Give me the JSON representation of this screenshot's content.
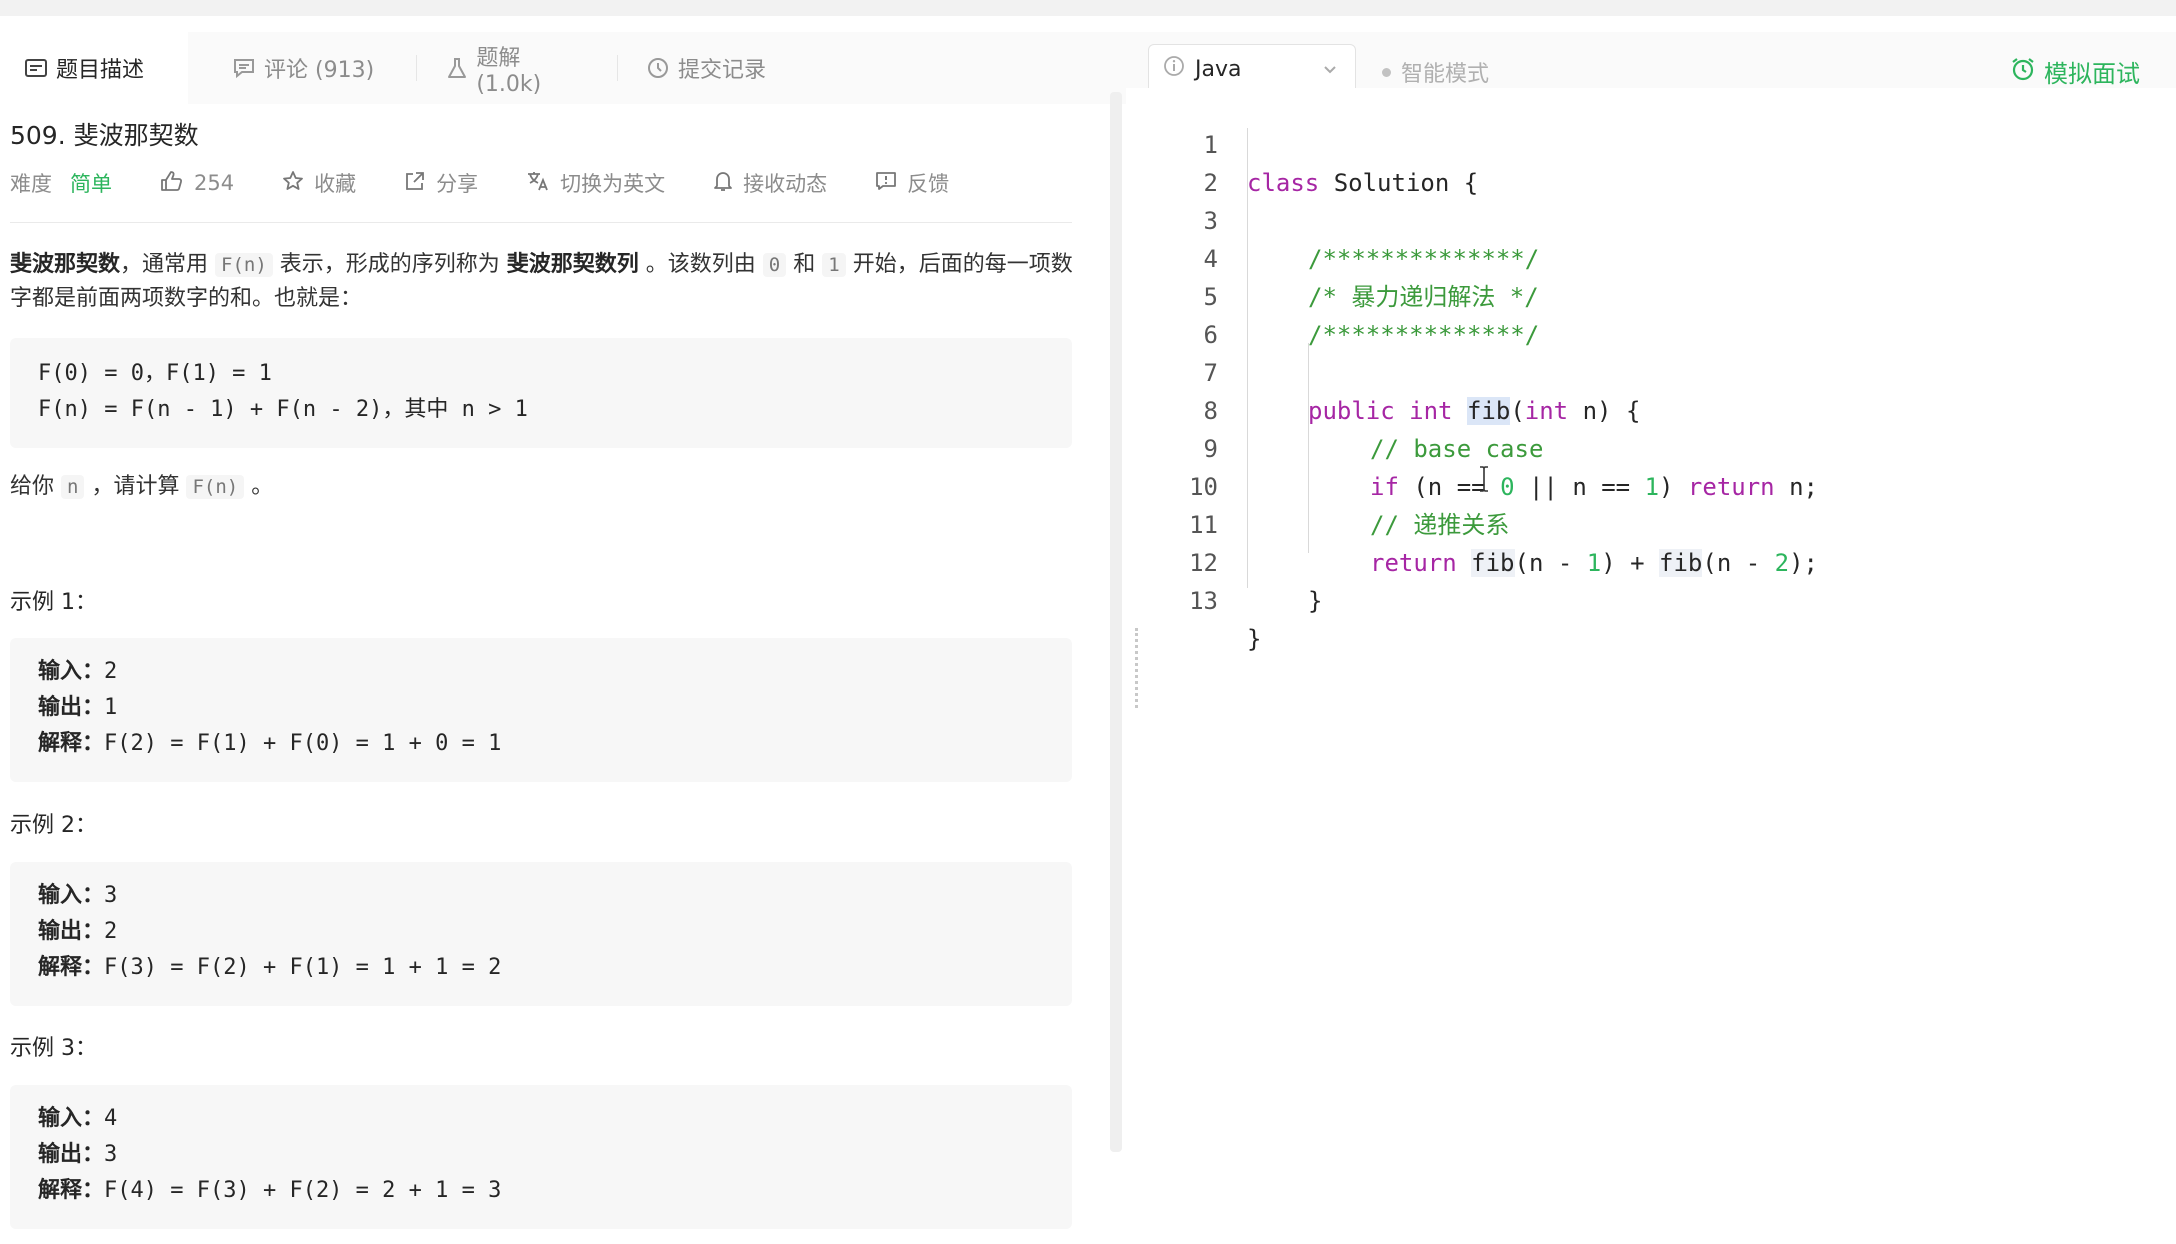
{
  "tabs": {
    "description": "题目描述",
    "comments": "评论 (913)",
    "solutions": "题解 (1.0k)",
    "submissions": "提交记录"
  },
  "toolbar": {
    "language": "Java",
    "smart_mode": "智能模式",
    "mock_interview": "模拟面试"
  },
  "problem": {
    "title": "509. 斐波那契数",
    "difficulty_label": "难度",
    "difficulty": "简单",
    "likes": "254",
    "favorite": "收藏",
    "share": "分享",
    "switch_lang": "切换为英文",
    "subscribe": "接收动态",
    "feedback": "反馈",
    "intro": {
      "b1": "斐波那契数",
      "t1": "，通常用 ",
      "c1": "F(n)",
      "t2": " 表示，形成的序列称为 ",
      "b2": "斐波那契数列",
      "t3": " 。该数列由 ",
      "c2": "0",
      "t4": " 和 ",
      "c3": "1",
      "t5": " 开始，后面的每一项数字都是前面两项数字的和。也就是："
    },
    "formula": {
      "line1": "F(0) = 0，F(1) = 1",
      "line2": "F(n) = F(n - 1) + F(n - 2)，其中 n > 1"
    },
    "ask": {
      "t1": "给你 ",
      "c1": "n",
      "t2": " ，请计算 ",
      "c2": "F(n)",
      "t3": " 。"
    },
    "examples": [
      {
        "title": "示例 1：",
        "in_label": "输入：",
        "in": "2",
        "out_label": "输出：",
        "out": "1",
        "exp_label": "解释：",
        "exp": "F(2) = F(1) + F(0) = 1 + 0 = 1"
      },
      {
        "title": "示例 2：",
        "in_label": "输入：",
        "in": "3",
        "out_label": "输出：",
        "out": "2",
        "exp_label": "解释：",
        "exp": "F(3) = F(2) + F(1) = 1 + 1 = 2"
      },
      {
        "title": "示例 3：",
        "in_label": "输入：",
        "in": "4",
        "out_label": "输出：",
        "out": "3",
        "exp_label": "解释：",
        "exp": "F(4) = F(3) + F(2) = 2 + 1 = 3"
      }
    ]
  },
  "code": {
    "line_numbers": [
      "1",
      "2",
      "3",
      "4",
      "5",
      "6",
      "7",
      "8",
      "9",
      "10",
      "11",
      "12",
      "13"
    ],
    "l1_kw": "class",
    "l1_rest": " Solution {",
    "l3": "/**************/",
    "l4": "/* 暴力递归解法 */",
    "l5": "/**************/",
    "l7_kw1": "public",
    "l7_kw2": "int",
    "l7_fn": "fib",
    "l7_p": "(",
    "l7_kw3": "int",
    "l7_rest": " n) {",
    "l8": "// base case",
    "l9_kw": "if",
    "l9_a": " (n == ",
    "l9_n0": "0",
    "l9_b": " || n == ",
    "l9_n1": "1",
    "l9_c": ") ",
    "l9_kw2": "return",
    "l9_d": " n;",
    "l10": "// 递推关系",
    "l11_kw": "return",
    "l11_f1": "fib",
    "l11_a": "(n - ",
    "l11_n1": "1",
    "l11_b": ") + ",
    "l11_f2": "fib",
    "l11_c": "(n - ",
    "l11_n2": "2",
    "l11_d": ");",
    "l12": "}",
    "l13": "}"
  }
}
